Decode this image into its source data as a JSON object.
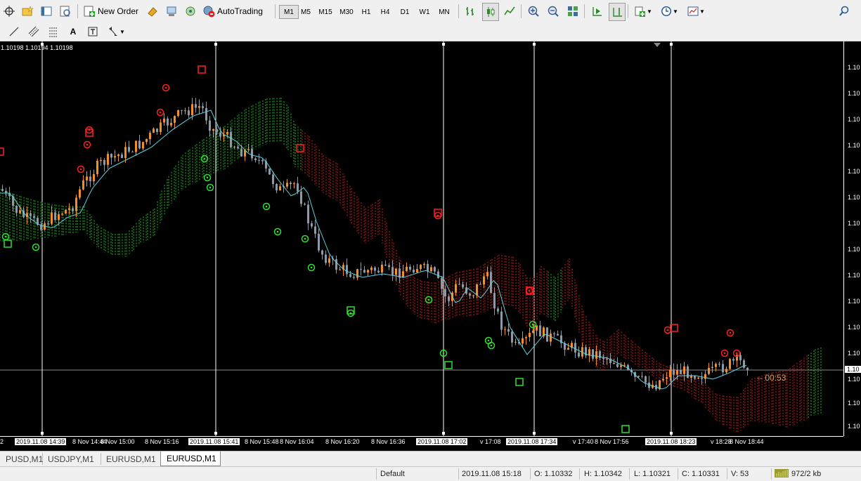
{
  "toolbar": {
    "new_order_label": "New Order",
    "autotrading_label": "AutoTrading",
    "timeframes": [
      "M1",
      "M5",
      "M15",
      "M30",
      "H1",
      "H4",
      "D1",
      "W1",
      "MN"
    ],
    "active_timeframe": "M1"
  },
  "chart": {
    "ohlc_text": "1.10198 1.10194 1.10198",
    "price_labels": [
      "1.10",
      "1.10",
      "1.10",
      "1.10",
      "1.10",
      "1.10",
      "1.10",
      "1.10",
      "1.10",
      "1.10",
      "1.10",
      "1.10",
      "1.10",
      "1.10",
      "1.10"
    ],
    "current_price_label": "1.10",
    "timer": "00:53",
    "time_labels": [
      {
        "text": "2",
        "hl": false
      },
      {
        "text": "2019.11.08 14:39",
        "hl": true
      },
      {
        "text": "8 Nov 14:44",
        "hl": false
      },
      {
        "text": "8 Nov 15:00",
        "hl": false
      },
      {
        "text": "8 Nov 15:16",
        "hl": false
      },
      {
        "text": "2019.11.08 15:41",
        "hl": true
      },
      {
        "text": "8 Nov 15:48",
        "hl": false
      },
      {
        "text": "8 Nov 16:04",
        "hl": false
      },
      {
        "text": "8 Nov 16:20",
        "hl": false
      },
      {
        "text": "8 Nov 16:36",
        "hl": false
      },
      {
        "text": "2019.11.08 17:02",
        "hl": true
      },
      {
        "text": "v 17:08",
        "hl": false
      },
      {
        "text": "2019.11.08 17:34",
        "hl": true
      },
      {
        "text": "v 17:40",
        "hl": false
      },
      {
        "text": "8 Nov 17:56",
        "hl": false
      },
      {
        "text": "2019.11.08 18:23",
        "hl": true
      },
      {
        "text": "v 18:28",
        "hl": false
      },
      {
        "text": "8 Nov 18:44",
        "hl": false
      }
    ]
  },
  "tabs": [
    "PUSD,M1",
    "USDJPY,M1",
    "EURUSD,M1",
    "EURUSD,M1"
  ],
  "active_tab": 3,
  "status": {
    "profile": "Default",
    "datetime": "2019.11.08 15:18",
    "open": "O: 1.10332",
    "high": "H: 1.10342",
    "low": "L: 1.10321",
    "close": "C: 1.10331",
    "volume": "V: 53",
    "traffic": "972/2 kb"
  },
  "colors": {
    "bull_candle": "#f0902a",
    "bear_candle": "#8c9aa8",
    "kijun": "#5fd0e0",
    "cloud_bull": "#22c022",
    "cloud_bear": "#d02020",
    "buy_marker": "#30e030",
    "sell_marker": "#ff2020"
  }
}
